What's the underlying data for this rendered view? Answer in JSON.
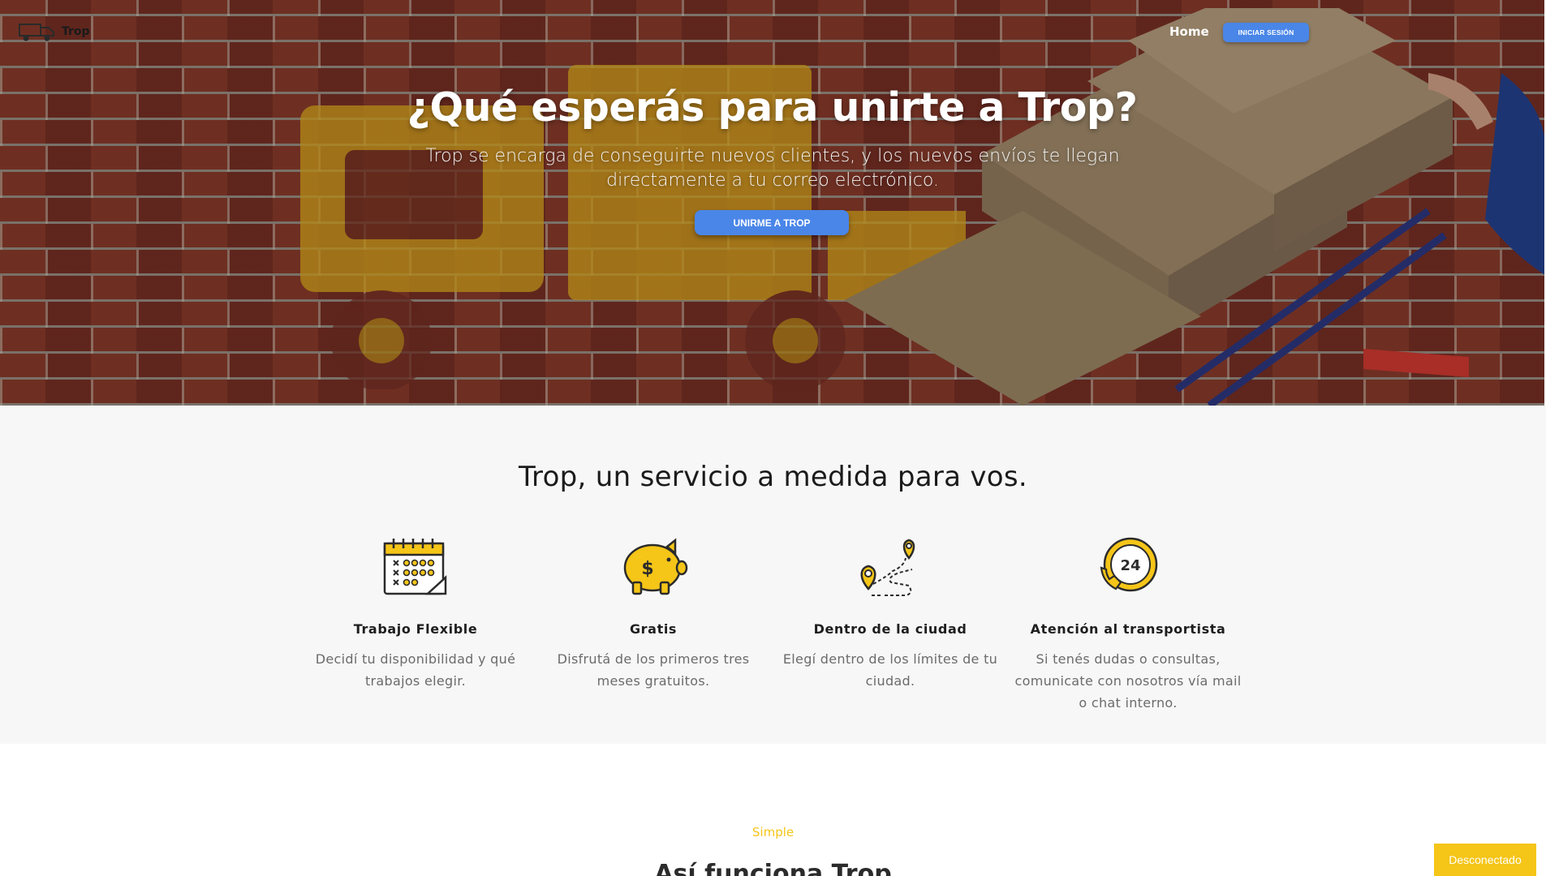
{
  "nav": {
    "brand": "Trop",
    "home_label": "Home",
    "login_label": "INICIAR SESIÓN"
  },
  "hero": {
    "title": "¿Qué esperás para unirte a Trop?",
    "subtitle": "Trop se encarga de conseguirte nuevos clientes, y los nuevos envíos te llegan directamente a tu correo electrónico.",
    "cta_label": "UNIRME A TROP"
  },
  "features": {
    "title": "Trop, un servicio a medida para vos.",
    "items": [
      {
        "icon": "calendar-icon",
        "title": "Trabajo Flexible",
        "text": "Decidí tu disponibilidad y qué trabajos elegir."
      },
      {
        "icon": "piggy-bank-icon",
        "title": "Gratis",
        "text": "Disfrutá de los primeros tres meses gratuitos."
      },
      {
        "icon": "route-pin-icon",
        "title": "Dentro de la ciudad",
        "text": "Elegí dentro de los límites de tu ciudad."
      },
      {
        "icon": "support-24h-icon",
        "title": "Atención al transportista",
        "text": "Si tenés dudas o consultas, comunicate  con nosotros vía mail o chat interno."
      }
    ]
  },
  "how": {
    "eyebrow": "Simple",
    "title": "Así funciona Trop"
  },
  "status": {
    "label": "Desconectado"
  },
  "colors": {
    "accent_blue": "#4a86e8",
    "accent_yellow": "#f5c518",
    "section_bg": "#f7f7f7"
  }
}
